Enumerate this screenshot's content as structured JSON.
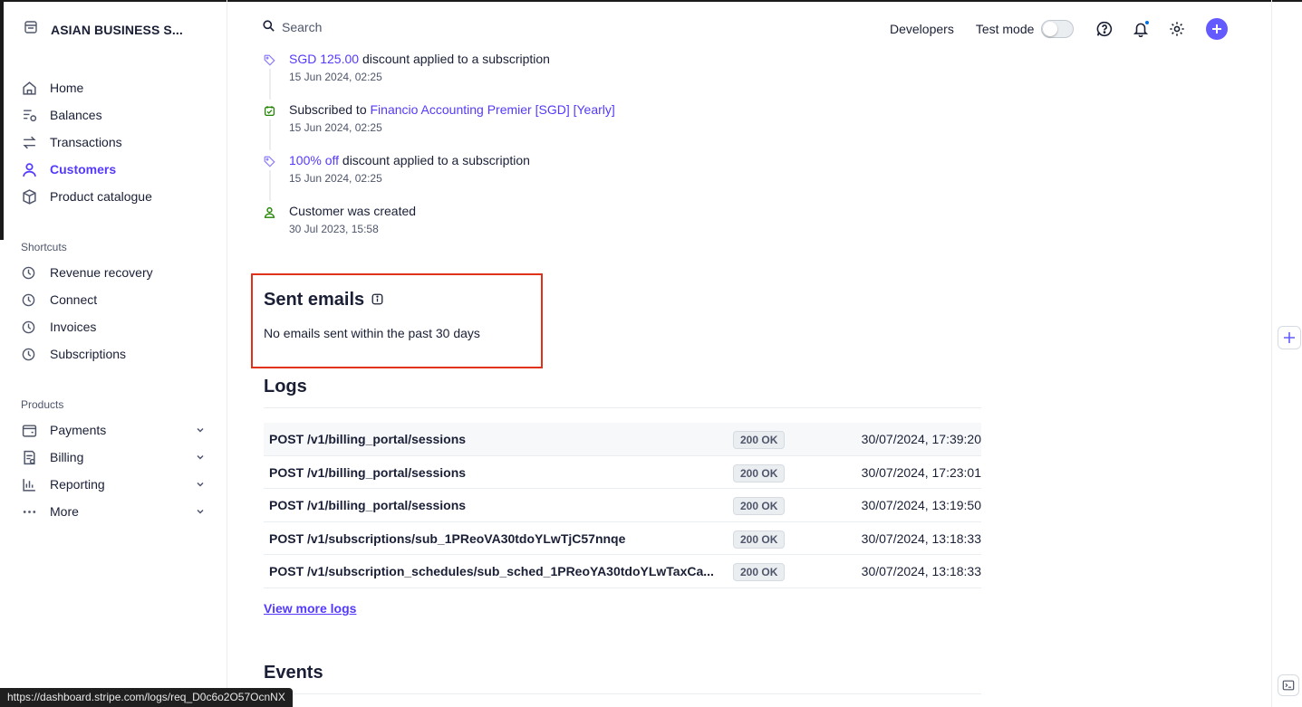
{
  "sidebar": {
    "account_name": "ASIAN BUSINESS S...",
    "main_nav": [
      {
        "label": "Home",
        "icon": "home-icon"
      },
      {
        "label": "Balances",
        "icon": "balances-icon"
      },
      {
        "label": "Transactions",
        "icon": "transactions-icon"
      },
      {
        "label": "Customers",
        "icon": "customers-icon",
        "active": true
      },
      {
        "label": "Product catalogue",
        "icon": "product-catalogue-icon"
      }
    ],
    "shortcuts_label": "Shortcuts",
    "shortcuts": [
      {
        "label": "Revenue recovery",
        "icon": "clock-icon"
      },
      {
        "label": "Connect",
        "icon": "clock-icon"
      },
      {
        "label": "Invoices",
        "icon": "clock-icon"
      },
      {
        "label": "Subscriptions",
        "icon": "clock-icon"
      }
    ],
    "products_label": "Products",
    "products": [
      {
        "label": "Payments",
        "icon": "payments-icon"
      },
      {
        "label": "Billing",
        "icon": "billing-icon"
      },
      {
        "label": "Reporting",
        "icon": "reporting-icon"
      },
      {
        "label": "More",
        "icon": "more-icon"
      }
    ]
  },
  "header": {
    "search_placeholder": "Search",
    "developers": "Developers",
    "test_mode": "Test mode"
  },
  "timeline": [
    {
      "link": "SGD 125.00",
      "text": " discount applied to a subscription",
      "date": "15 Jun 2024, 02:25",
      "icon": "tag-icon"
    },
    {
      "prefix": "Subscribed to ",
      "link": "Financio Accounting Premier [SGD] [Yearly]",
      "date": "15 Jun 2024, 02:25",
      "icon": "subscription-icon"
    },
    {
      "link": "100% off",
      "text": " discount applied to a subscription",
      "date": "15 Jun 2024, 02:25",
      "icon": "tag-icon"
    },
    {
      "text": "Customer was created",
      "date": "30 Jul 2023, 15:58",
      "icon": "person-icon"
    }
  ],
  "sent_emails": {
    "title": "Sent emails",
    "empty": "No emails sent within the past 30 days"
  },
  "logs": {
    "title": "Logs",
    "rows": [
      {
        "path": "POST /v1/billing_portal/sessions",
        "status": "200 OK",
        "time": "30/07/2024, 17:39:20"
      },
      {
        "path": "POST /v1/billing_portal/sessions",
        "status": "200 OK",
        "time": "30/07/2024, 17:23:01"
      },
      {
        "path": "POST /v1/billing_portal/sessions",
        "status": "200 OK",
        "time": "30/07/2024, 13:19:50"
      },
      {
        "path": "POST /v1/subscriptions/sub_1PReoVA30tdoYLwTjC57nnqe",
        "status": "200 OK",
        "time": "30/07/2024, 13:18:33"
      },
      {
        "path": "POST /v1/subscription_schedules/sub_sched_1PReoYA30tdoYLwTaxCa...",
        "status": "200 OK",
        "time": "30/07/2024, 13:18:33"
      }
    ],
    "view_more": "View more logs"
  },
  "events": {
    "title": "Events"
  },
  "status_url": "https://dashboard.stripe.com/logs/req_D0c6o2O57OcnNX",
  "colors": {
    "accent": "#533afd",
    "highlight_border": "#e0321a",
    "text": "#1a1f36"
  }
}
